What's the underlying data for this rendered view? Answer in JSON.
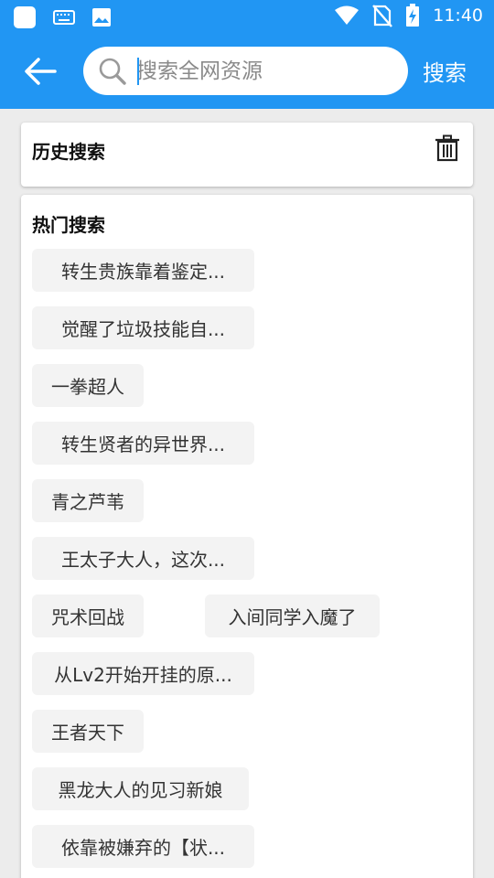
{
  "status_bar": {
    "time": "11:40",
    "icons": [
      "app-icon",
      "keyboard-icon",
      "image-icon",
      "wifi-icon",
      "no-sim-icon",
      "battery-icon"
    ]
  },
  "toolbar": {
    "search_placeholder": "搜索全网资源",
    "search_label": "搜索"
  },
  "history": {
    "title": "历史搜索"
  },
  "hot": {
    "title": "热门搜索",
    "items": [
      "转生贵族靠着鉴定...",
      "觉醒了垃圾技能自...",
      "一拳超人",
      "转生贤者的异世界...",
      "青之芦苇",
      "王太子大人，这次...",
      "咒术回战",
      "入间同学入魔了",
      "从Lv2开始开挂的原...",
      "王者天下",
      "黑龙大人的见习新娘",
      "依靠被嫌弃的【状..."
    ]
  },
  "colors": {
    "accent": "#2196F3",
    "background": "#ececec",
    "chip": "#f3f3f3"
  }
}
